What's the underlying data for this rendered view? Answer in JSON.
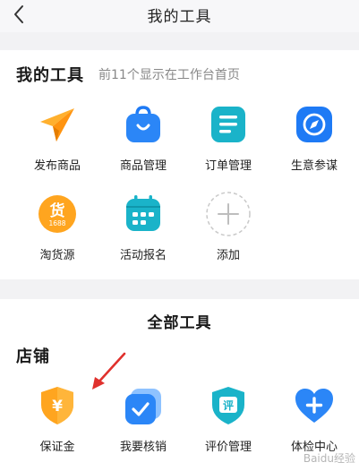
{
  "header": {
    "title": "我的工具"
  },
  "my_tools": {
    "title": "我的工具",
    "subtitle": "前11个显示在工作台首页",
    "items": [
      {
        "label": "发布商品",
        "icon": "paper-plane-icon"
      },
      {
        "label": "商品管理",
        "icon": "shopping-bag-icon"
      },
      {
        "label": "订单管理",
        "icon": "order-list-icon"
      },
      {
        "label": "生意参谋",
        "icon": "compass-icon"
      },
      {
        "label": "淘货源",
        "icon": "huo-source-icon",
        "badge_main": "货",
        "badge_sub": "1688"
      },
      {
        "label": "活动报名",
        "icon": "calendar-icon"
      },
      {
        "label": "添加",
        "icon": "add-icon"
      }
    ]
  },
  "all_tools": {
    "title": "全部工具",
    "shop": {
      "title": "店铺",
      "items": [
        {
          "label": "保证金",
          "icon": "deposit-shield-icon",
          "glyph": "¥"
        },
        {
          "label": "我要核销",
          "icon": "verify-check-icon"
        },
        {
          "label": "评价管理",
          "icon": "review-icon",
          "glyph": "评"
        },
        {
          "label": "体检中心",
          "icon": "health-heart-icon"
        }
      ]
    }
  },
  "colors": {
    "orange": "#ffa51f",
    "blue": "#1e7af5",
    "teal": "#1ab3c9",
    "annotation_red": "#e0312d"
  },
  "watermark": "Baidu经验"
}
